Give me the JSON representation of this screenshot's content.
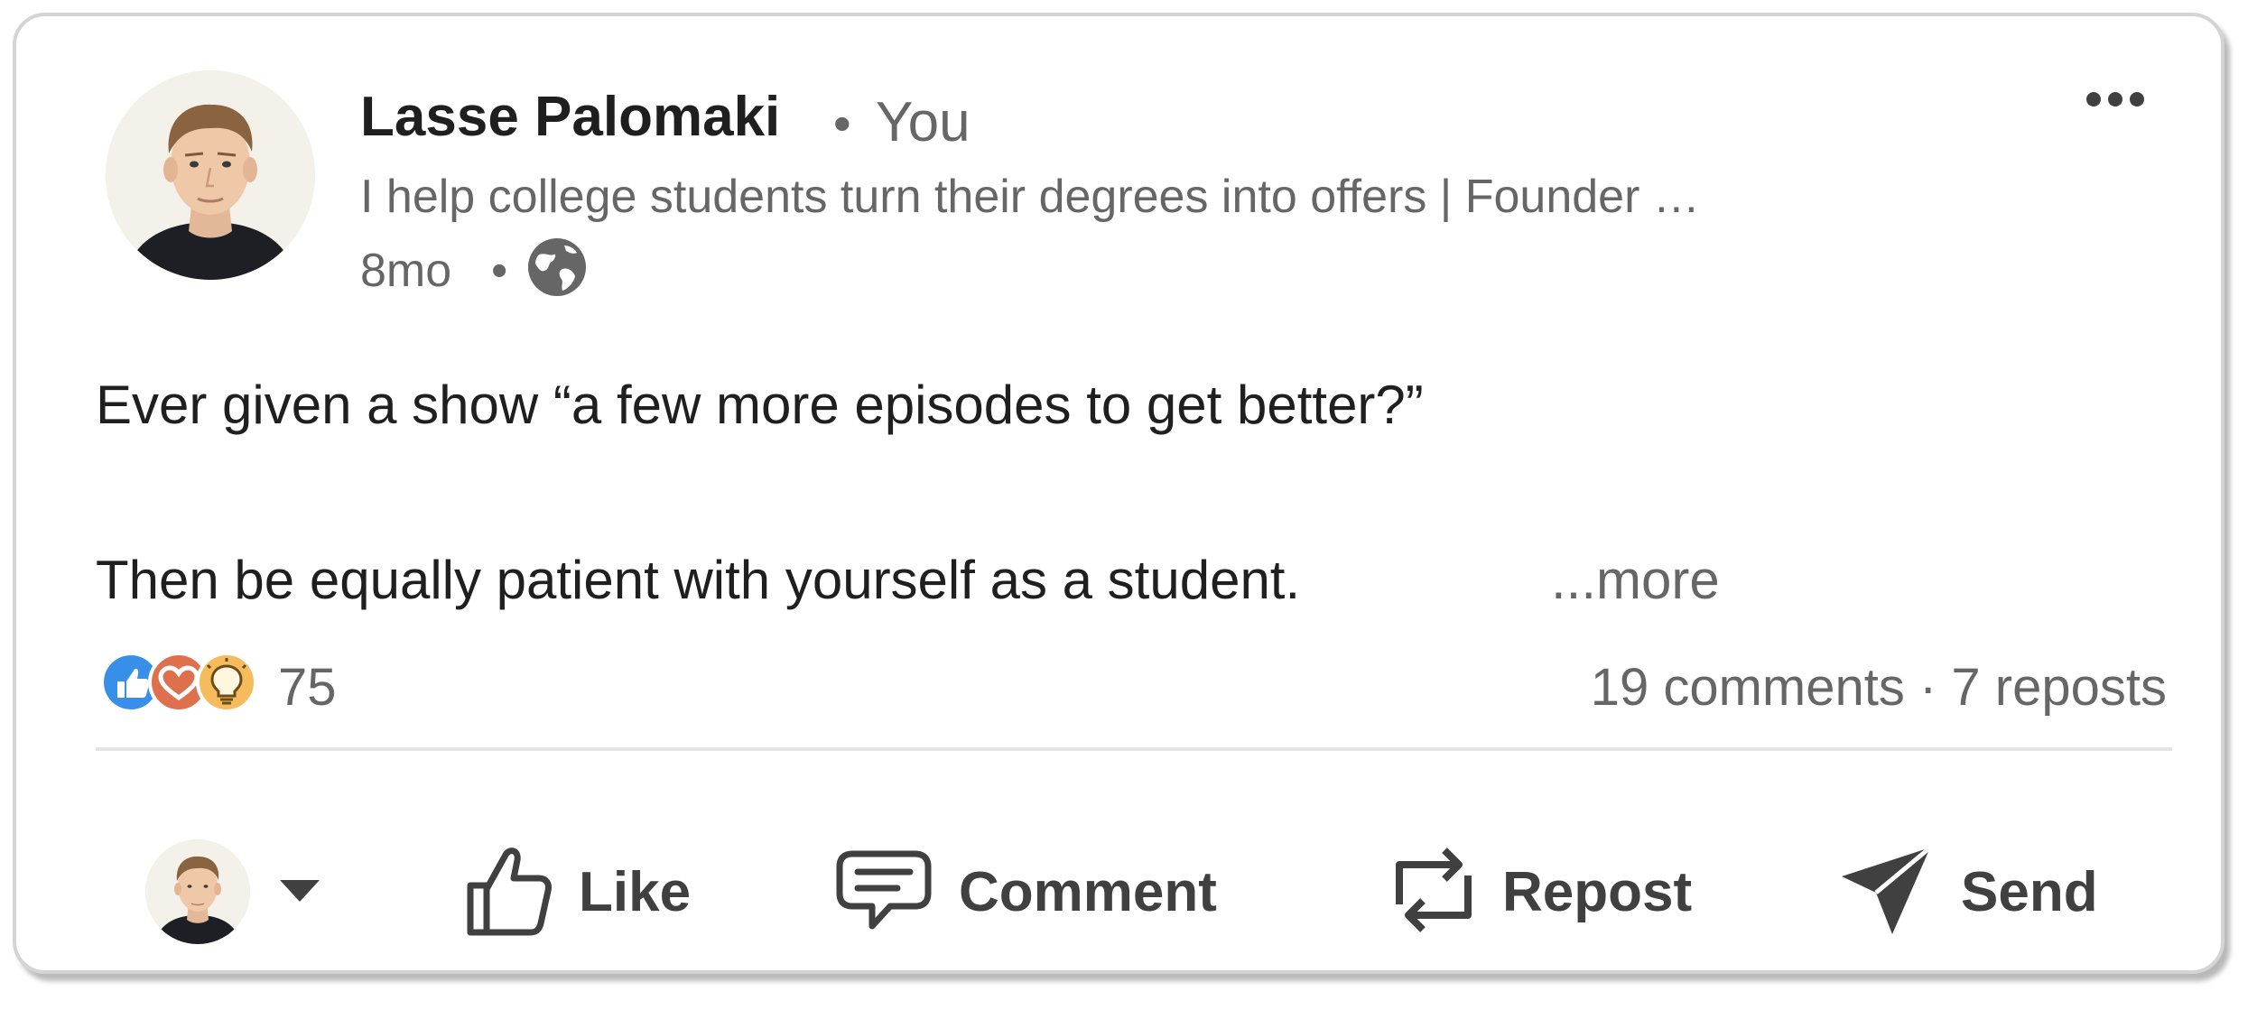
{
  "post": {
    "author": {
      "name": "Lasse Palomaki",
      "relation_separator": "•",
      "relation": "You",
      "headline": "I help college students turn their degrees into offers | Founder …",
      "time_ago": "8mo",
      "time_separator": "•",
      "visibility_icon": "globe-icon"
    },
    "menu_icon": "more-horizontal-icon",
    "body": {
      "line1": "Ever given a show “a few more episodes to get better?”",
      "line2": "Then be equally patient with yourself as a student.",
      "more_label": "...more"
    },
    "reactions": {
      "icons": [
        "like-reaction-icon",
        "love-reaction-icon",
        "insightful-reaction-icon"
      ],
      "count": "75",
      "stats": "19 comments · 7 reposts"
    }
  },
  "actions": {
    "react_as_icon": "caret-down-icon",
    "like_label": "Like",
    "comment_label": "Comment",
    "repost_label": "Repost",
    "send_label": "Send"
  },
  "colors": {
    "like_blue": "#378fe9",
    "love_red": "#df704d",
    "insightful_yellow": "#f5bb5c",
    "text_primary": "#1f1f1f",
    "text_secondary": "#666666",
    "action_gray": "#404040"
  }
}
